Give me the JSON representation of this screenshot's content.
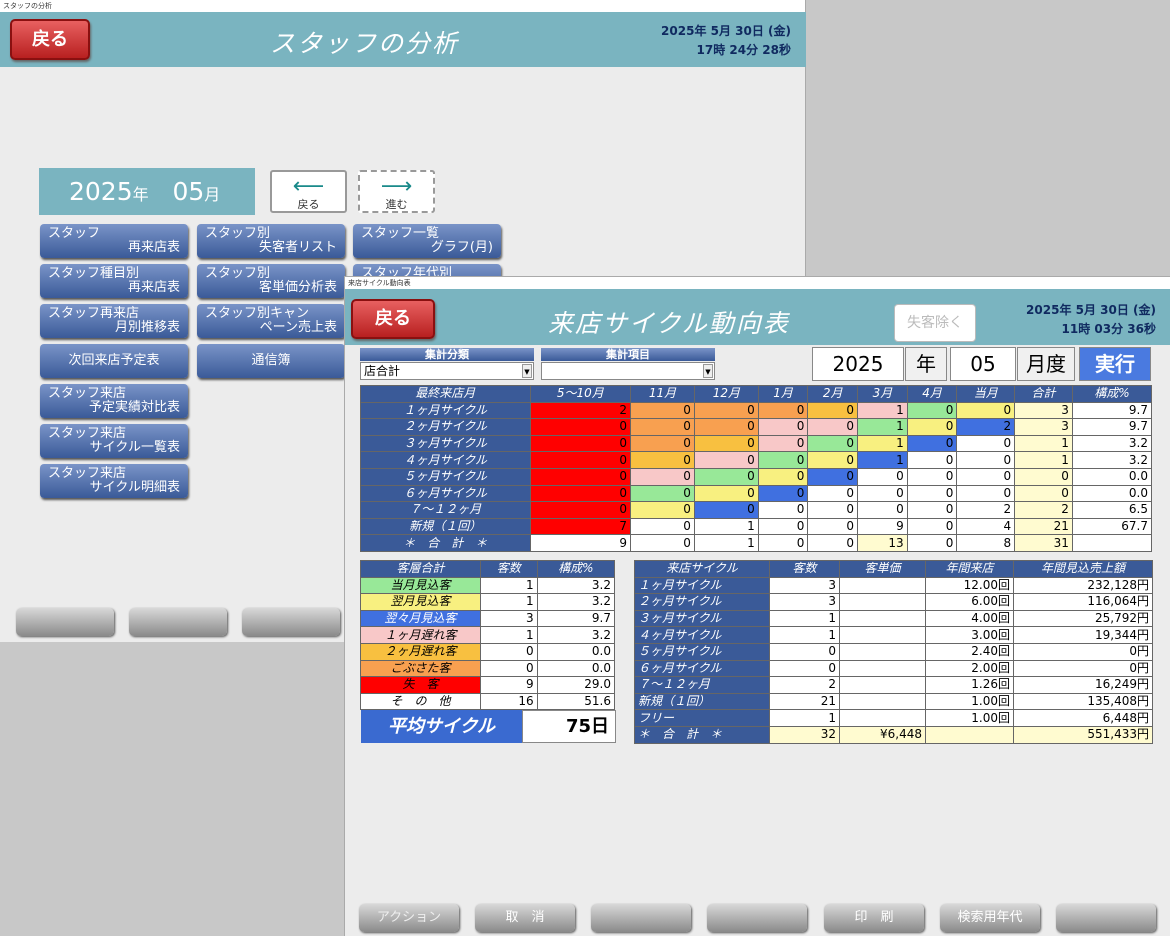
{
  "win1": {
    "title_bar": "スタッフの分析",
    "back": "戻る",
    "title": "スタッフの分析",
    "date": "2025年 5月 30日 (金)",
    "time": "17時 24分 28秒",
    "year": "2025",
    "year_unit": "年",
    "month": "05",
    "month_unit": "月",
    "prev_label": "戻る",
    "next_label": "進む",
    "buttons": [
      {
        "l1": "スタッフ",
        "l2": "再来店表"
      },
      {
        "l1": "スタッフ別",
        "l2": "失客者リスト"
      },
      {
        "l1": "スタッフ一覧",
        "l2": "グラフ(月)"
      },
      {
        "l1": "スタッフ種目別",
        "l2": "再来店表"
      },
      {
        "l1": "スタッフ別",
        "l2": "客単価分析表"
      },
      {
        "l1": "スタッフ年代別",
        "l2": ""
      },
      {
        "l1": "スタッフ再来店",
        "l2": "月別推移表"
      },
      {
        "l1": "スタッフ別キャン",
        "l2": "ペーン売上表"
      },
      {
        "l1": "次回来店予定表",
        "l2": ""
      },
      {
        "l1": "通信簿",
        "l2": ""
      },
      {
        "l1": "スタッフ来店",
        "l2": "予定実績対比表"
      },
      {
        "l1": "スタッフ来店",
        "l2": "サイクル一覧表"
      },
      {
        "l1": "スタッフ来店",
        "l2": "サイクル明細表"
      }
    ]
  },
  "win2": {
    "title_bar": "来店サイクル動向表",
    "back": "戻る",
    "title": "来店サイクル動向表",
    "exclude": "失客除く",
    "date": "2025年 5月 30日 (金)",
    "time": "11時 03分 36秒",
    "agg_label": "集計分類",
    "agg_value": "店合計",
    "item_label": "集計項目",
    "item_value": "",
    "year": "2025",
    "year_unit": "年",
    "month": "05",
    "month_unit": "月度",
    "run": "実行",
    "main_headers": [
      "最終来店月",
      "5～10月",
      "11月",
      "12月",
      "1月",
      "2月",
      "3月",
      "4月",
      "当月",
      "合計",
      "構成%"
    ],
    "main_rows": [
      {
        "label": "１ヶ月サイクル",
        "cells": [
          "2",
          "0",
          "0",
          "0",
          "0",
          "1",
          "0",
          "0",
          "3",
          "9.7"
        ]
      },
      {
        "label": "２ヶ月サイクル",
        "cells": [
          "0",
          "0",
          "0",
          "0",
          "0",
          "1",
          "0",
          "2",
          "3",
          "9.7"
        ]
      },
      {
        "label": "３ヶ月サイクル",
        "cells": [
          "0",
          "0",
          "0",
          "0",
          "0",
          "1",
          "0",
          "0",
          "1",
          "3.2"
        ]
      },
      {
        "label": "４ヶ月サイクル",
        "cells": [
          "0",
          "0",
          "0",
          "0",
          "0",
          "1",
          "0",
          "0",
          "1",
          "3.2"
        ]
      },
      {
        "label": "５ヶ月サイクル",
        "cells": [
          "0",
          "0",
          "0",
          "0",
          "0",
          "0",
          "0",
          "0",
          "0",
          "0.0"
        ]
      },
      {
        "label": "６ヶ月サイクル",
        "cells": [
          "0",
          "0",
          "0",
          "0",
          "0",
          "0",
          "0",
          "0",
          "0",
          "0.0"
        ]
      },
      {
        "label": "７～１２ヶ月",
        "cells": [
          "0",
          "0",
          "0",
          "0",
          "0",
          "0",
          "0",
          "2",
          "2",
          "6.5"
        ]
      },
      {
        "label": "新規（１回）",
        "cells": [
          "7",
          "0",
          "1",
          "0",
          "0",
          "9",
          "0",
          "4",
          "21",
          "67.7"
        ]
      },
      {
        "label": "＊　合　計　＊",
        "cells": [
          "9",
          "0",
          "1",
          "0",
          "0",
          "13",
          "0",
          "8",
          "31",
          ""
        ]
      }
    ],
    "cust_headers": [
      "客層合計",
      "客数",
      "構成%"
    ],
    "cust_rows": [
      {
        "label": "当月見込客",
        "count": "1",
        "pct": "3.2",
        "color": "#98e898"
      },
      {
        "label": "翌月見込客",
        "count": "1",
        "pct": "3.2",
        "color": "#f8f080"
      },
      {
        "label": "翌々月見込客",
        "count": "3",
        "pct": "9.7",
        "color": "#4070e0"
      },
      {
        "label": "１ヶ月遅れ客",
        "count": "1",
        "pct": "3.2",
        "color": "#f8c8c8"
      },
      {
        "label": "２ヶ月遅れ客",
        "count": "0",
        "pct": "0.0",
        "color": "#f8c040"
      },
      {
        "label": "ごぶさた客",
        "count": "0",
        "pct": "0.0",
        "color": "#f8a050"
      },
      {
        "label": "失　客",
        "count": "9",
        "pct": "29.0",
        "color": "#ff0000"
      },
      {
        "label": "そ　の　他",
        "count": "16",
        "pct": "51.6",
        "color": "#ffffff"
      }
    ],
    "avg_label": "平均サイクル",
    "avg_value": "75日",
    "cyc_headers": [
      "来店サイクル",
      "客数",
      "客単価",
      "年間来店",
      "年間見込売上額"
    ],
    "cyc_rows": [
      {
        "label": "１ヶ月サイクル",
        "count": "3",
        "unit": "",
        "visits": "12.00回",
        "sales": "232,128円"
      },
      {
        "label": "２ヶ月サイクル",
        "count": "3",
        "unit": "",
        "visits": "6.00回",
        "sales": "116,064円"
      },
      {
        "label": "３ヶ月サイクル",
        "count": "1",
        "unit": "",
        "visits": "4.00回",
        "sales": "25,792円"
      },
      {
        "label": "４ヶ月サイクル",
        "count": "1",
        "unit": "",
        "visits": "3.00回",
        "sales": "19,344円"
      },
      {
        "label": "５ヶ月サイクル",
        "count": "0",
        "unit": "",
        "visits": "2.40回",
        "sales": "0円"
      },
      {
        "label": "６ヶ月サイクル",
        "count": "0",
        "unit": "",
        "visits": "2.00回",
        "sales": "0円"
      },
      {
        "label": "７～１２ヶ月",
        "count": "2",
        "unit": "",
        "visits": "1.26回",
        "sales": "16,249円"
      },
      {
        "label": "新規（１回）",
        "count": "21",
        "unit": "",
        "visits": "1.00回",
        "sales": "135,408円"
      },
      {
        "label": "フリー",
        "count": "1",
        "unit": "",
        "visits": "1.00回",
        "sales": "6,448円"
      },
      {
        "label": "＊　合　計　＊",
        "count": "32",
        "unit": "¥6,448",
        "visits": "",
        "sales": "551,433円"
      }
    ],
    "bottom_buttons": [
      "アクション",
      "取　消",
      "",
      "",
      "印　刷",
      "検索用年代",
      ""
    ]
  },
  "colors": {
    "header": "#7ab4c0",
    "navy": "#3a5a98"
  }
}
